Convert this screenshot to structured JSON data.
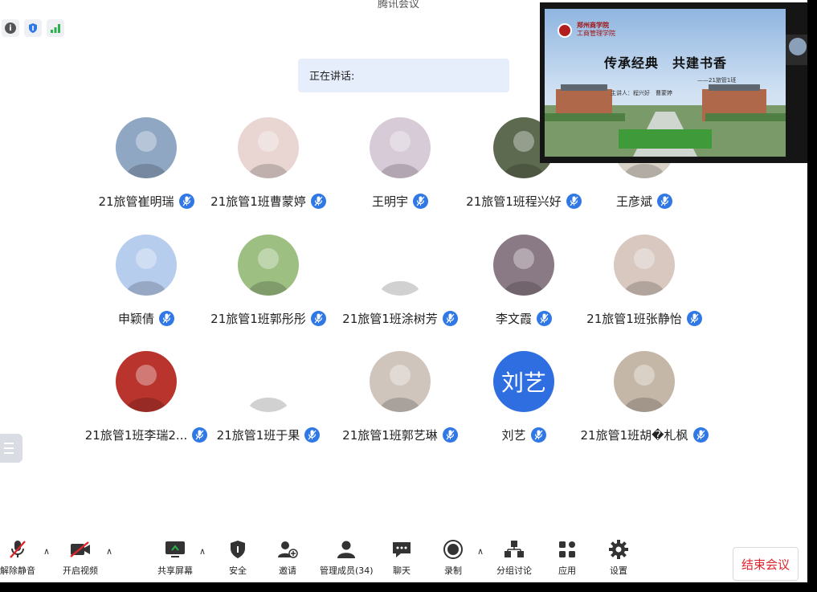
{
  "app": {
    "title": "腾讯会议"
  },
  "speaking": {
    "label": "正在讲话:"
  },
  "share": {
    "school": "郑州商学院",
    "school_sub": "工商管理学院",
    "slide_title": "传承经典　共建书香",
    "slide_subtitle": "——21旅管1班",
    "presenters": "主讲人：程兴好　曹蒙婷"
  },
  "participants": [
    {
      "name": "21旅管崔明瑞",
      "avatar_color": "#8fa7c2"
    },
    {
      "name": "21旅管1班曹蒙婷",
      "avatar_color": "#e9d6d3"
    },
    {
      "name": "王明宇",
      "avatar_color": "#d8cbd8"
    },
    {
      "name": "21旅管1班程兴好",
      "avatar_color": "#5d6a4f"
    },
    {
      "name": "王彦斌",
      "avatar_color": "#d9d2c8"
    },
    {
      "name": "申颖倩",
      "avatar_color": "#b7cdee"
    },
    {
      "name": "21旅管1班郭彤彤",
      "avatar_color": "#9dbf82"
    },
    {
      "name": "21旅管1班涂树芳",
      "avatar_color": "#ffffff"
    },
    {
      "name": "李文霞",
      "avatar_color": "#8a7a86"
    },
    {
      "name": "21旅管1班张静怡",
      "avatar_color": "#d8c8c0"
    },
    {
      "name": "21旅管1班李瑞2...",
      "avatar_color": "#b9342c"
    },
    {
      "name": "21旅管1班于果",
      "avatar_color": "#ffffff"
    },
    {
      "name": "21旅管1班郭艺琳",
      "avatar_color": "#cfc5bd"
    },
    {
      "name": "刘艺",
      "avatar_color": "#2f6ee0",
      "avatar_text": "刘艺"
    },
    {
      "name": "21旅管1班胡�札枫",
      "avatar_color": "#c5b7a8"
    }
  ],
  "toolbar": {
    "unmute": "解除静音",
    "video": "开启视频",
    "share": "共享屏幕",
    "security": "安全",
    "invite": "邀请",
    "members": "管理成员(34)",
    "chat": "聊天",
    "record": "录制",
    "breakout": "分组讨论",
    "apps": "应用",
    "settings": "设置",
    "end": "结束会议"
  },
  "colors": {
    "accent": "#2f78e6",
    "end": "#e0242b",
    "banner": "#e6eefc"
  }
}
